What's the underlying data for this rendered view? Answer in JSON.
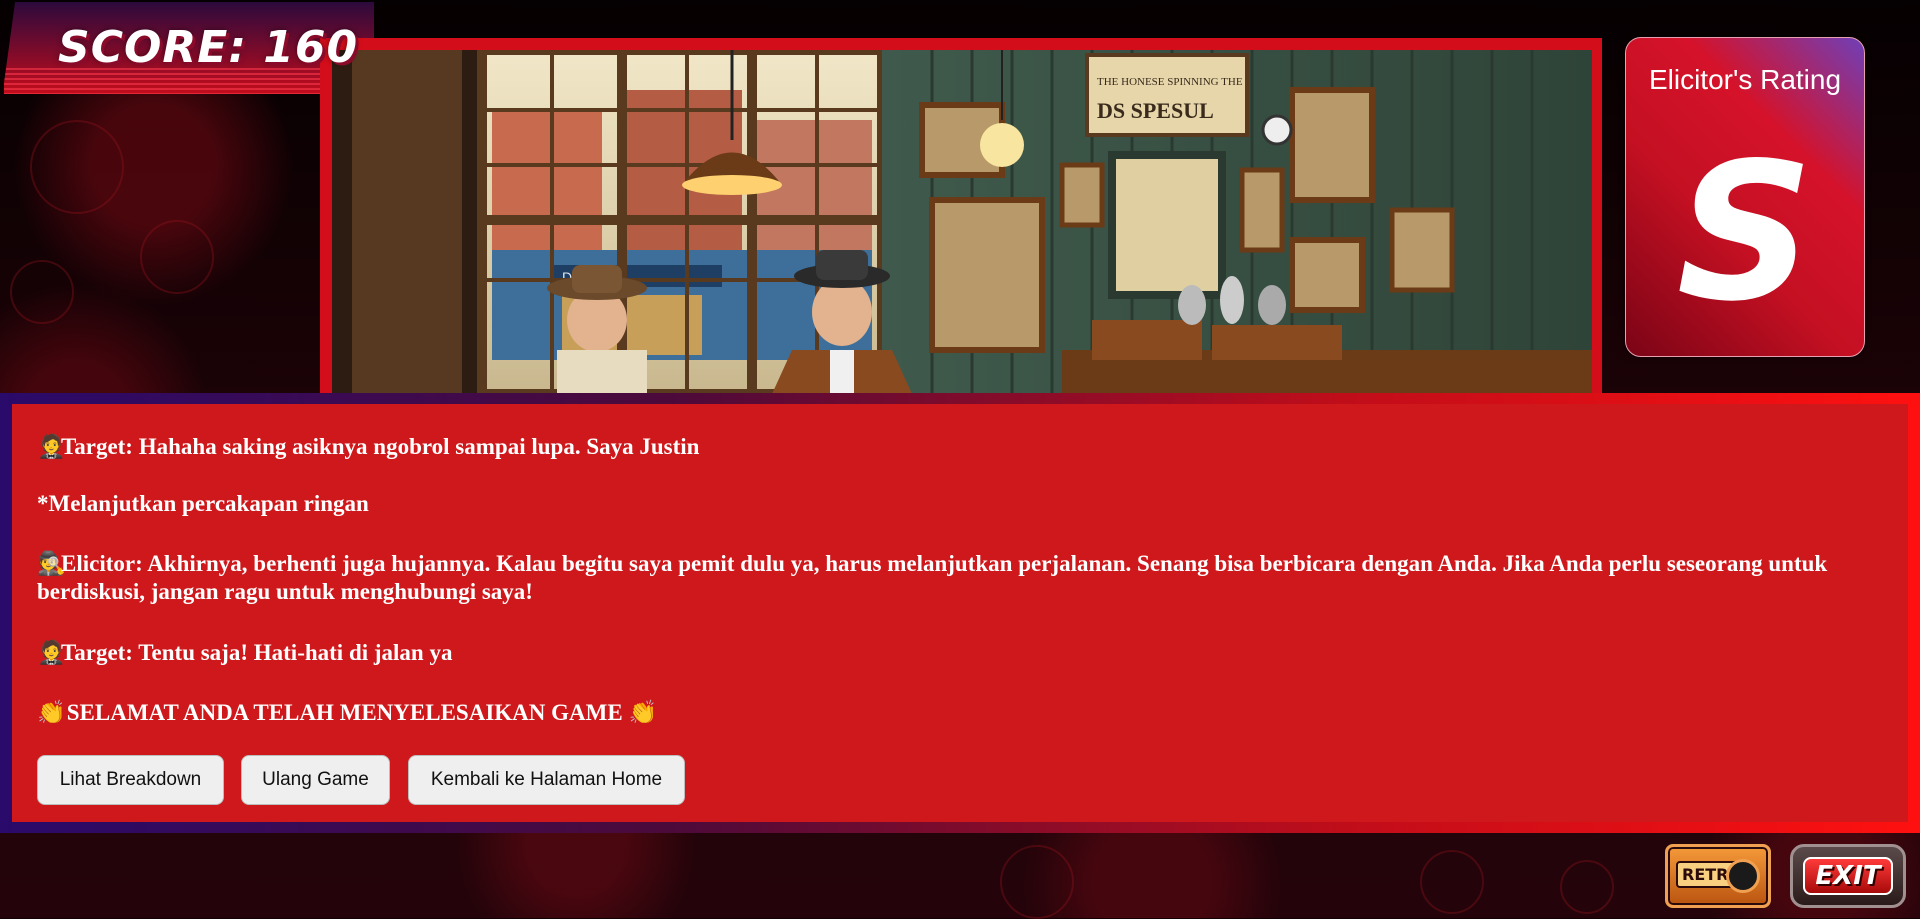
{
  "score": {
    "text": "SCORE: 160"
  },
  "scene": {
    "sign_line1": "THE HONESE SPINNING THE",
    "sign_line2": "DS SPESUL",
    "shop_sign": "DENICOP"
  },
  "rating": {
    "title": "Elicitor's Rating",
    "value": "S"
  },
  "dialogue": {
    "lines": [
      {
        "emoji": "🤵",
        "text": "Target: Hahaha saking asiknya ngobrol sampai lupa. Saya Justin"
      },
      {
        "emoji": "",
        "text": "*Melanjutkan percakapan ringan"
      },
      {
        "emoji": "🕵",
        "text": "Elicitor: Akhirnya, berhenti juga hujannya. Kalau begitu saya pemit dulu ya, harus melanjutkan perjalanan. Senang bisa berbicara dengan Anda. Jika Anda perlu seseorang untuk berdiskusi, jangan ragu untuk menghubungi saya!"
      },
      {
        "emoji": "🤵",
        "text": "Target: Tentu saja! Hati-hati di jalan ya"
      },
      {
        "emoji": "👏",
        "text": "SELAMAT ANDA TELAH MENYELESAIKAN GAME",
        "emoji_end": "👏"
      }
    ],
    "buttons": {
      "breakdown": "Lihat Breakdown",
      "restart": "Ulang Game",
      "home": "Kembali ke Halaman Home"
    }
  },
  "bottom": {
    "retry": "RETRY",
    "exit": "EXIT"
  }
}
